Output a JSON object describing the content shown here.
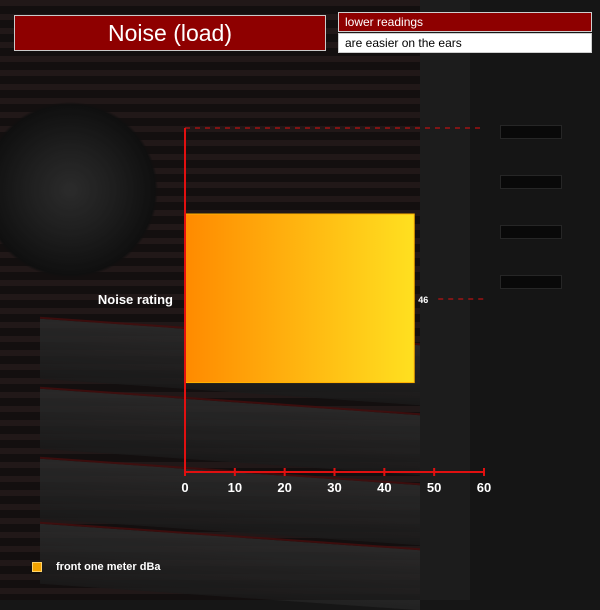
{
  "header": {
    "title": "Noise (load)",
    "note_line1": "lower readings",
    "note_line2": "are easier on the ears"
  },
  "colors": {
    "title_bg": "#8e0000",
    "axis": "#e01010",
    "bar_start": "#ff8a00",
    "bar_end": "#ffe020"
  },
  "chart_data": {
    "type": "bar",
    "orientation": "horizontal",
    "categories": [
      "Noise rating"
    ],
    "series": [
      {
        "name": "front one meter dBa",
        "values": [
          46
        ]
      }
    ],
    "data_labels": [
      "46"
    ],
    "xlim": [
      0,
      60
    ],
    "xticks": [
      "0",
      "10",
      "20",
      "30",
      "40",
      "50",
      "60"
    ],
    "grid": false,
    "legend_position": "bottom-left"
  }
}
